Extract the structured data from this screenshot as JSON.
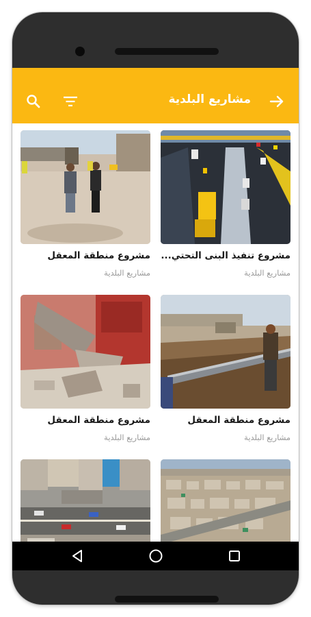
{
  "appbar": {
    "title": "مشاريع البلدية",
    "back_icon": "arrow-right-icon",
    "filter_icon": "filter-icon",
    "search_icon": "search-icon",
    "background": "#fbb812"
  },
  "cards": [
    {
      "title": "مشروع تنفيذ البنى التحتي...",
      "subtitle": "مشاريع البلدية",
      "image": "highway-construction-photo"
    },
    {
      "title": "مشروع منطقة المعقل",
      "subtitle": "مشاريع البلدية",
      "image": "officials-walking-road-photo"
    },
    {
      "title": "مشروع منطقة المعقل",
      "subtitle": "مشاريع البلدية",
      "image": "pipe-laying-trench-photo"
    },
    {
      "title": "مشروع منطقة المعقل",
      "subtitle": "مشاريع البلدية",
      "image": "building-demolition-photo"
    },
    {
      "title": "",
      "subtitle": "",
      "image": "aerial-city-photo"
    },
    {
      "title": "",
      "subtitle": "",
      "image": "aerial-street-photo"
    }
  ],
  "navbar": {
    "back_icon": "nav-back-icon",
    "home_icon": "nav-home-icon",
    "recents_icon": "nav-recents-icon"
  }
}
